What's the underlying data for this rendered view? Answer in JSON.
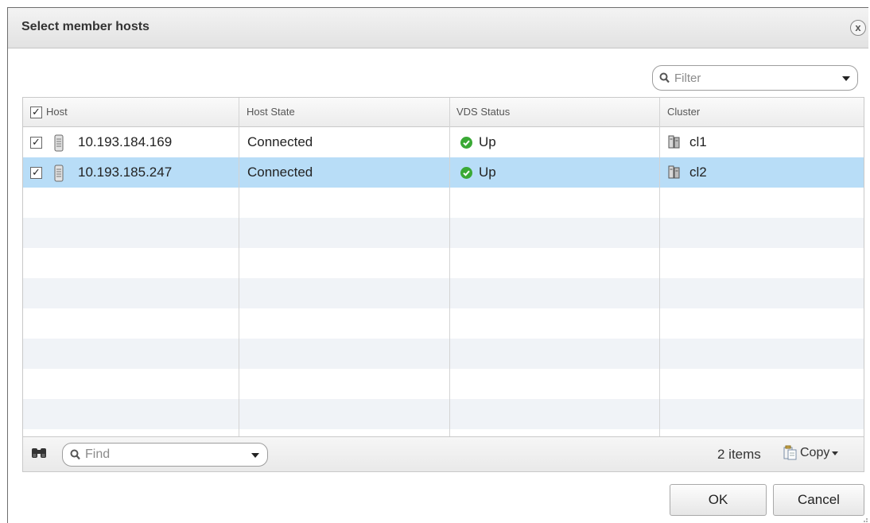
{
  "dialog": {
    "title": "Select member hosts",
    "close_glyph": "x",
    "close_icon": "close-circle-icon"
  },
  "filter": {
    "placeholder": "Filter",
    "icon": "search-icon"
  },
  "table": {
    "columns": [
      {
        "label": "Host",
        "has_select_all": true,
        "select_all_checked": true
      },
      {
        "label": "Host State"
      },
      {
        "label": "VDS Status"
      },
      {
        "label": "Cluster"
      }
    ],
    "rows": [
      {
        "checked": true,
        "host": "10.193.184.169",
        "host_icon": "host-server-icon",
        "state": "Connected",
        "vds_status": "Up",
        "vds_icon": "green-check-circle-icon",
        "cluster": "cl1",
        "cluster_icon": "cluster-icon",
        "selected": false
      },
      {
        "checked": true,
        "host": "10.193.185.247",
        "host_icon": "host-server-icon",
        "state": "Connected",
        "vds_status": "Up",
        "vds_icon": "green-check-circle-icon",
        "cluster": "cl2",
        "cluster_icon": "cluster-icon",
        "selected": true
      }
    ]
  },
  "footer": {
    "find_placeholder": "Find",
    "find_icon": "binoculars-icon",
    "item_count": "2 items",
    "copy_label": "Copy",
    "copy_icon": "copy-clipboard-icon"
  },
  "buttons": {
    "ok": "OK",
    "cancel": "Cancel"
  },
  "colors": {
    "selected_row": "#b8ddf7",
    "alt_row": "#f0f3f7",
    "status_up": "#3aa935"
  }
}
